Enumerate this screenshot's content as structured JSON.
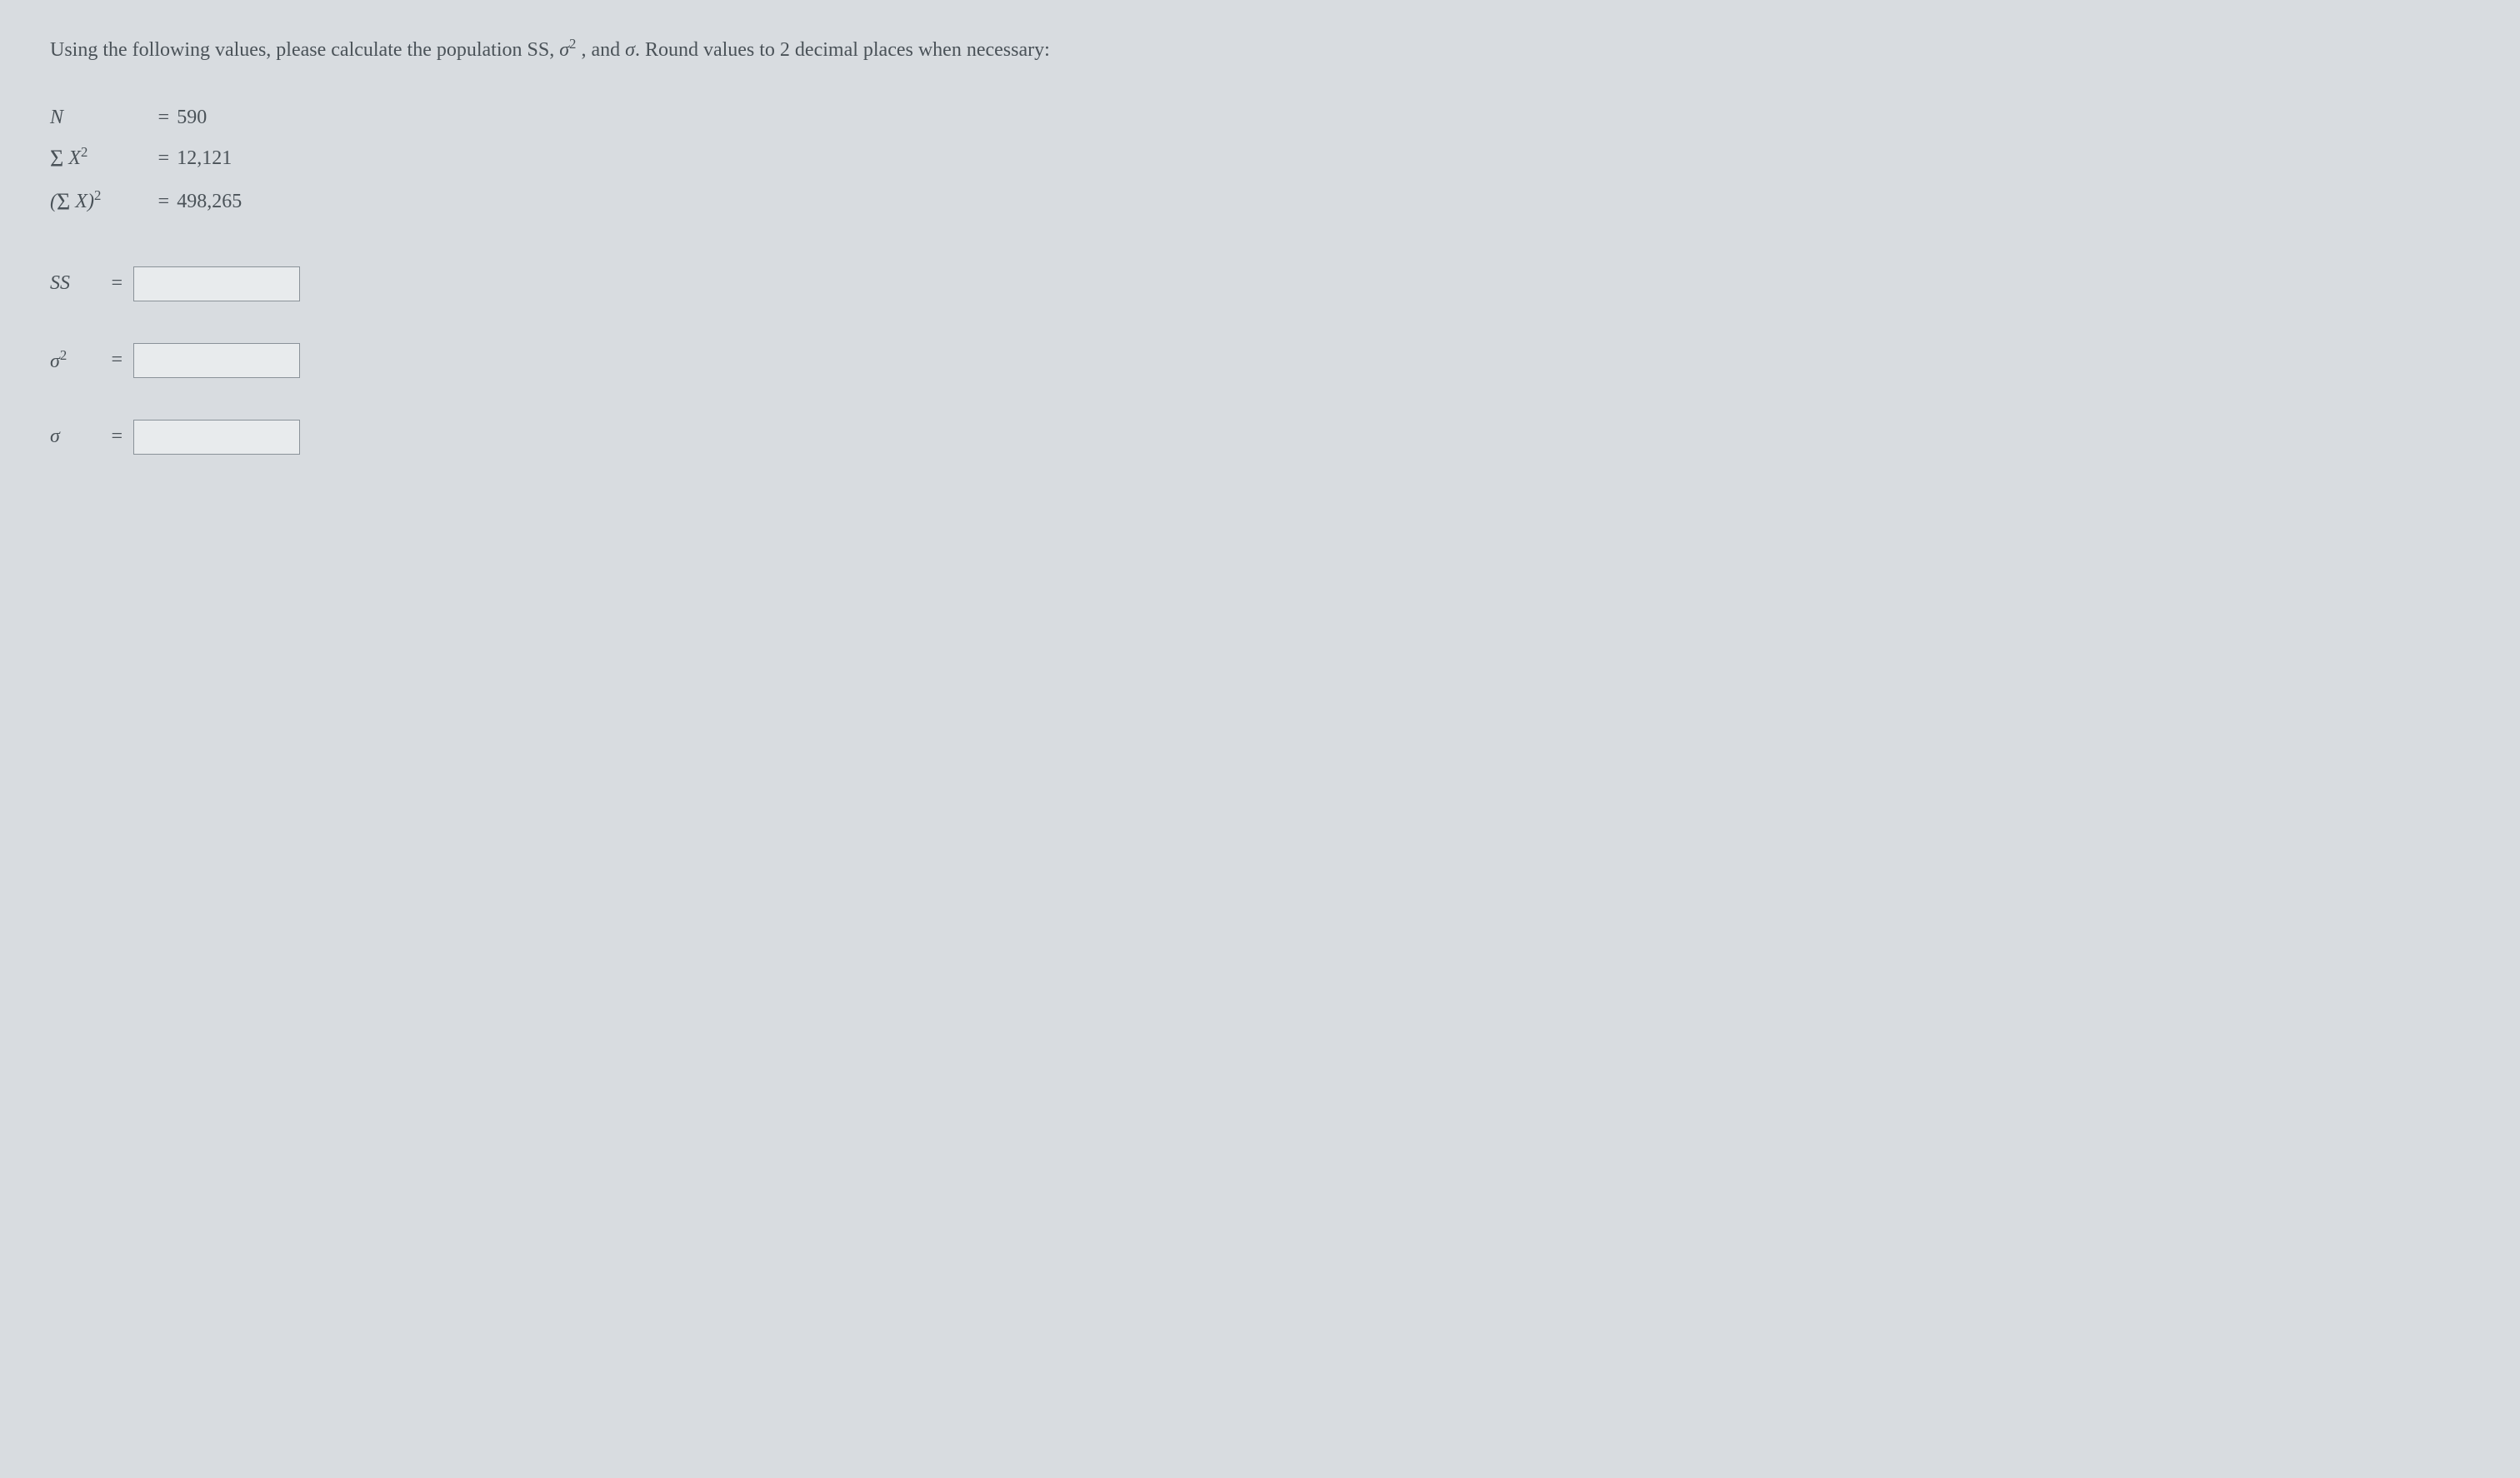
{
  "prompt": {
    "text_before_sigma2": "Using the following values, please calculate the population SS, ",
    "sigma2": "σ",
    "text_mid": " , and ",
    "sigma": "σ",
    "text_after": ". Round values to 2 decimal places when necessary:"
  },
  "given": {
    "n": {
      "symbol": "N",
      "eq": "=",
      "value": "590"
    },
    "sumx2": {
      "symbol_sigma": "Σ",
      "symbol_x": " X",
      "eq": "=",
      "value": "12,121"
    },
    "sumx_sq": {
      "symbol_open": "(",
      "symbol_sigma": "Σ",
      "symbol_x": " X)",
      "eq": "=",
      "value": "498,265"
    }
  },
  "answers": {
    "ss": {
      "label": "SS",
      "eq": "="
    },
    "var": {
      "label": "σ",
      "eq": "="
    },
    "sd": {
      "label": "σ",
      "eq": "="
    }
  }
}
